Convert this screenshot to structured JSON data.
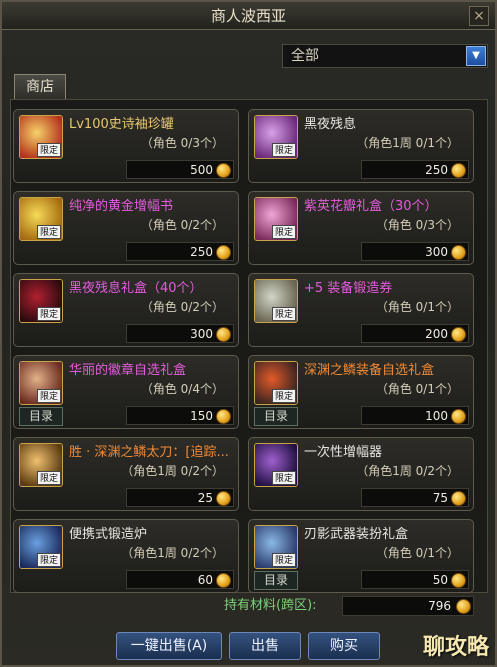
{
  "window": {
    "title": "商人波西亚",
    "close_label": "×"
  },
  "filter": {
    "value": "全部",
    "arrow": "▼"
  },
  "tabs": {
    "shop": "商店"
  },
  "tags": {
    "limited": "限定",
    "catalog": "目录"
  },
  "items": [
    {
      "name": "Lv100史诗袖珍罐",
      "limit": "（角色 0/3个）",
      "price": "500",
      "name_color": "gold",
      "icon": "gold-jar-icon",
      "catalog": false
    },
    {
      "name": "黑夜残息",
      "limit": "（角色1周 0/1个）",
      "price": "250",
      "name_color": "white",
      "icon": "night-remnant-icon",
      "catalog": false
    },
    {
      "name": "纯净的黄金增幅书",
      "limit": "（角色 0/2个）",
      "price": "250",
      "name_color": "pink",
      "icon": "golden-book-icon",
      "catalog": false
    },
    {
      "name": "紫英花瓣礼盒（30个）",
      "limit": "（角色 0/3个）",
      "price": "300",
      "name_color": "pink",
      "icon": "petal-box-icon",
      "catalog": false
    },
    {
      "name": "黑夜残息礼盒（40个）",
      "limit": "（角色 0/2个）",
      "price": "300",
      "name_color": "pink",
      "icon": "night-box-icon",
      "catalog": false
    },
    {
      "name": "+5 装备锻造券",
      "limit": "（角色 0/1个）",
      "price": "200",
      "name_color": "pink",
      "icon": "forge-ticket-icon",
      "catalog": false
    },
    {
      "name": "华丽的徽章自选礼盒",
      "limit": "（角色 0/4个）",
      "price": "150",
      "name_color": "pink",
      "icon": "emblem-box-icon",
      "catalog": true
    },
    {
      "name": "深渊之鳞装备自选礼盒",
      "limit": "（角色 0/1个）",
      "price": "100",
      "name_color": "orange",
      "icon": "abyss-equip-box-icon",
      "catalog": true
    },
    {
      "name": "胜 · 深渊之鳞太刀：[追踪...",
      "limit": "（角色1周 0/2个）",
      "price": "25",
      "name_color": "orange",
      "icon": "katana-icon",
      "catalog": false
    },
    {
      "name": "一次性增幅器",
      "limit": "（角色1周 0/2个）",
      "price": "75",
      "name_color": "white",
      "icon": "amplifier-icon",
      "catalog": false
    },
    {
      "name": "便携式锻造炉",
      "limit": "（角色1周 0/2个）",
      "price": "60",
      "name_color": "white",
      "icon": "forge-furnace-icon",
      "catalog": false
    },
    {
      "name": "刃影武器装扮礼盒",
      "limit": "（角色 0/1个）",
      "price": "50",
      "name_color": "white",
      "icon": "weapon-avatar-box-icon",
      "catalog": true
    }
  ],
  "materials": {
    "label": "持有材料(跨区):",
    "amount": "796"
  },
  "buttons": {
    "sell_all": "一键出售(A)",
    "sell": "出售",
    "buy": "购买"
  },
  "watermark": "聊攻略"
}
